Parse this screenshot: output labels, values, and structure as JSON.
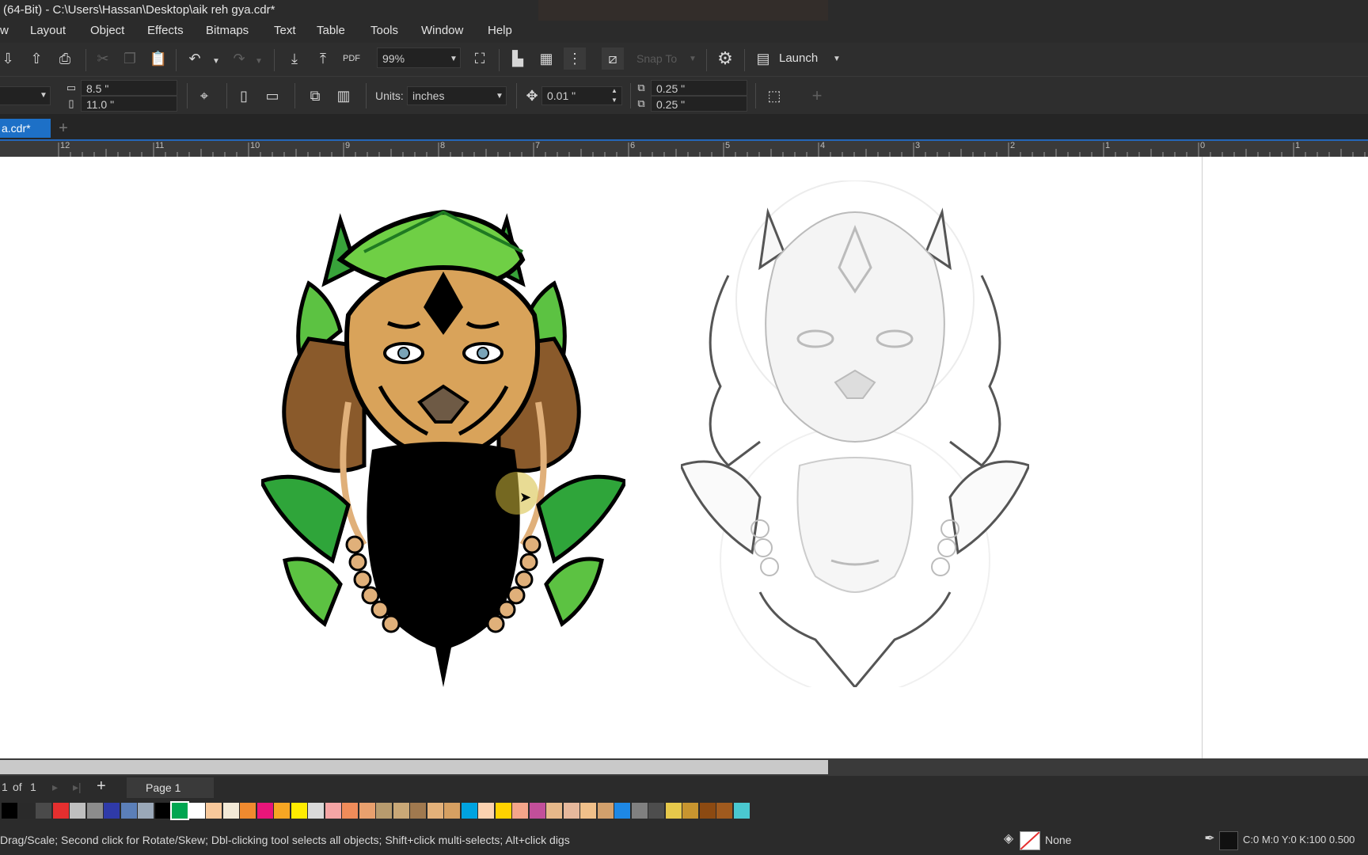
{
  "window": {
    "title": "(64-Bit) - C:\\Users\\Hassan\\Desktop\\aik reh gya.cdr*"
  },
  "menu": [
    "w",
    "Layout",
    "Object",
    "Effects",
    "Bitmaps",
    "Text",
    "Table",
    "Tools",
    "Window",
    "Help"
  ],
  "toolbar": {
    "zoom": "99%",
    "snap_label": "Snap To",
    "launch_label": "Launch"
  },
  "properties": {
    "width": "8.5 \"",
    "height": "11.0 \"",
    "units_label": "Units:",
    "units_value": "inches",
    "nudge": "0.01 \"",
    "dup_x": "0.25 \"",
    "dup_y": "0.25 \""
  },
  "document_tab": {
    "label": "a.cdr*"
  },
  "ruler": {
    "ticks": [
      "12",
      "11",
      "10",
      "9",
      "8",
      "7",
      "6",
      "5",
      "4",
      "3",
      "2",
      "1",
      "0",
      "1"
    ]
  },
  "pages": {
    "current": "1",
    "of_label": "of",
    "total": "1",
    "page_tab": "Page 1"
  },
  "palette": [
    "#000000",
    "#2a2a2a",
    "#4a4a4a",
    "#e52f2f",
    "#bfbfbf",
    "#8c8c8c",
    "#2f3aa8",
    "#5b7fb8",
    "#9aa8b8",
    "#000000",
    "#00a651",
    "#ffffff",
    "#f7c89b",
    "#f3e9d6",
    "#f08a2f",
    "#e8157a",
    "#f6a623",
    "#ffec00",
    "#d9d9d9",
    "#f4a5a5",
    "#f08c5a",
    "#e8a06e",
    "#b79b6e",
    "#c9a877",
    "#a0794f",
    "#e3b17a",
    "#d6a062",
    "#00a3e0",
    "#fbd2b0",
    "#ffd200",
    "#f4a58a",
    "#c24f9a",
    "#e6b88a",
    "#e6b89c",
    "#f0c08a",
    "#d2a06c",
    "#1e88e5",
    "#808080",
    "#4d4d4d",
    "#e6c84b",
    "#c8952f",
    "#8c4a12",
    "#a05a1e",
    "#4ac8d0"
  ],
  "status": {
    "hint": "Drag/Scale; Second click for Rotate/Skew; Dbl-clicking tool selects all objects; Shift+click multi-selects; Alt+click digs",
    "fill_label": "None",
    "outline_color": "C:0 M:0 Y:0 K:100  0.500"
  },
  "colors": {
    "accent": "#1d70c7",
    "leaf_light": "#7ed957",
    "leaf_dark": "#1f8a2a",
    "fur_tan": "#d9a35a",
    "mane_brown": "#8a5a2b",
    "bead": "#e0b07a"
  }
}
